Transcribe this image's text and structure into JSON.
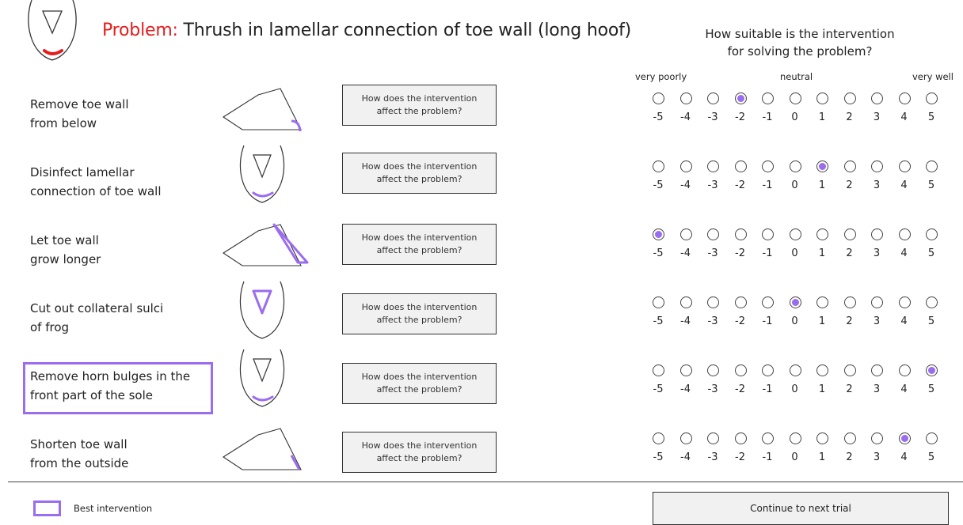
{
  "problem": {
    "prefix": "Problem:",
    "text": " Thrush in lamellar connection of toe wall (long hoof)",
    "icon": "hoof-sole-icon",
    "prefix_color": "#e61c1c",
    "highlight_color": "#e61c1c"
  },
  "rating": {
    "question_line1": "How suitable is the intervention",
    "question_line2": "for solving the problem?",
    "label_low": "very poorly",
    "label_mid": "neutral",
    "label_high": "very well",
    "scale": [
      "-5",
      "-4",
      "-3",
      "-2",
      "-1",
      "0",
      "1",
      "2",
      "3",
      "4",
      "5"
    ],
    "selected_color": "#9a6cf0"
  },
  "interventions": [
    {
      "line1": "Remove toe wall",
      "line2": "from below",
      "icon": "hoof-side-toe-below-icon",
      "button": "How does the intervention affect the problem?",
      "rating": "-2",
      "best": false
    },
    {
      "line1": "Disinfect lamellar",
      "line2": "connection of toe wall",
      "icon": "hoof-sole-toe-icon",
      "button": "How does the intervention affect the problem?",
      "rating": "1",
      "best": false
    },
    {
      "line1": "Let toe wall",
      "line2": "grow longer",
      "icon": "hoof-side-toe-longer-icon",
      "button": "How does the intervention affect the problem?",
      "rating": "-5",
      "best": false
    },
    {
      "line1": "Cut out collateral sulci",
      "line2": "of frog",
      "icon": "hoof-sole-frog-icon",
      "button": "How does the intervention affect the problem?",
      "rating": "0",
      "best": false
    },
    {
      "line1": "Remove horn bulges in the",
      "line2": "front part of the sole",
      "icon": "hoof-sole-front-icon",
      "button": "How does the intervention affect the problem?",
      "rating": "5",
      "best": true
    },
    {
      "line1": "Shorten toe wall",
      "line2": "from the outside",
      "icon": "hoof-side-toe-outside-icon",
      "button": "How does the intervention affect the problem?",
      "rating": "4",
      "best": false
    }
  ],
  "legend": {
    "label": "Best intervention",
    "color": "#9a6cf0"
  },
  "continue_label": "Continue to next trial"
}
